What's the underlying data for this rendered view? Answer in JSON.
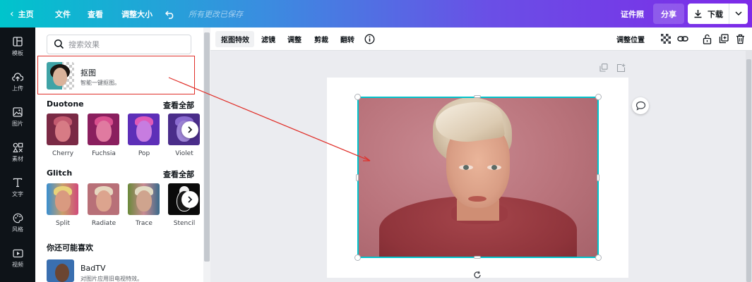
{
  "topbar": {
    "home": "主页",
    "file": "文件",
    "view": "查看",
    "resize": "调整大小",
    "saved_status": "所有更改已保存",
    "id_photo": "证件照",
    "share": "分享",
    "download": "下载"
  },
  "rail": [
    {
      "label": "模板",
      "icon": "template-icon"
    },
    {
      "label": "上传",
      "icon": "upload-icon"
    },
    {
      "label": "图片",
      "icon": "photo-icon"
    },
    {
      "label": "素材",
      "icon": "elements-icon"
    },
    {
      "label": "文字",
      "icon": "text-icon"
    },
    {
      "label": "风格",
      "icon": "style-icon"
    },
    {
      "label": "视频",
      "icon": "video-icon"
    }
  ],
  "panel": {
    "search_placeholder": "搜索效果",
    "bg_remover": {
      "title": "抠图",
      "subtitle": "智能一键抠图。"
    },
    "duotone": {
      "title": "Duotone",
      "see_all": "查看全部",
      "items": [
        "Cherry",
        "Fuchsia",
        "Pop",
        "Violet"
      ]
    },
    "glitch": {
      "title": "Glitch",
      "see_all": "查看全部",
      "items": [
        "Split",
        "Radiate",
        "Trace",
        "Stencil"
      ]
    },
    "suggestions": {
      "title": "你还可能喜欢",
      "items": [
        {
          "title": "BadTV",
          "subtitle": "对图片应用旧电视特效。"
        }
      ]
    }
  },
  "context_toolbar": {
    "bg_remover": "抠图特效",
    "filter": "滤镜",
    "adjust": "调整",
    "crop": "剪裁",
    "flip": "翻转",
    "position": "调整位置"
  },
  "colors": {
    "accent": "#00c4cc",
    "annotation_red": "#e0302a",
    "rail_bg": "#0e1318",
    "gradient_start": "#00c4cc",
    "gradient_end": "#7d2ae8"
  }
}
